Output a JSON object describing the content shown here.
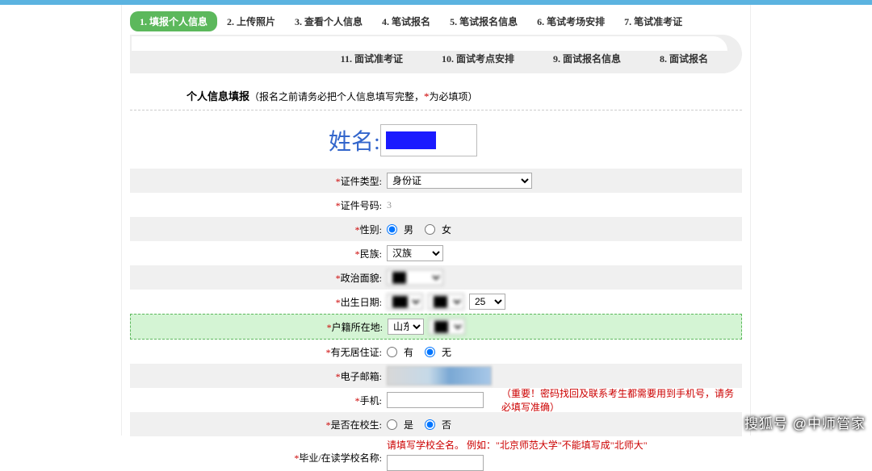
{
  "steps_row1": [
    "1. 填报个人信息",
    "2. 上传照片",
    "3. 查看个人信息",
    "4. 笔试报名",
    "5. 笔试报名信息",
    "6. 笔试考场安排",
    "7. 笔试准考证"
  ],
  "steps_row2": [
    "11. 面试准考证",
    "10. 面试考点安排",
    "9. 面试报名信息",
    "8. 面试报名"
  ],
  "section": {
    "title_bold": "个人信息填报",
    "note_prefix": "（报名之前请务必把个人信息填写完整，",
    "note_star": "*",
    "note_suffix": "为必填项）"
  },
  "form": {
    "name_label": "姓名:",
    "id_type_label": "证件类型:",
    "id_type_value": "身份证",
    "id_num_label": "证件号码:",
    "id_num_value": "3",
    "gender_label": "性别:",
    "gender_opts": [
      "男",
      "女"
    ],
    "ethnic_label": "民族:",
    "ethnic_value": "汉族",
    "political_label": "政治面貌:",
    "birth_label": "出生日期:",
    "birth_day": "25",
    "hukou_label": "户籍所在地:",
    "hukou_prov": "山东",
    "residence_label": "有无居住证:",
    "residence_opts": [
      "有",
      "无"
    ],
    "email_label": "电子邮箱:",
    "phone_label": "手机:",
    "phone_hint": "（重要！密码找回及联系考生都需要用到手机号，请务必填写准确）",
    "student_label": "是否在校生:",
    "student_opts": [
      "是",
      "否"
    ],
    "school_label": "毕业/在读学校名称:",
    "school_hint": "请填写学校全名。 例如：\"北京师范大学\"不能填写成\"北师大\"",
    "school_value": ""
  },
  "watermark": "搜狐号 @中师管家"
}
